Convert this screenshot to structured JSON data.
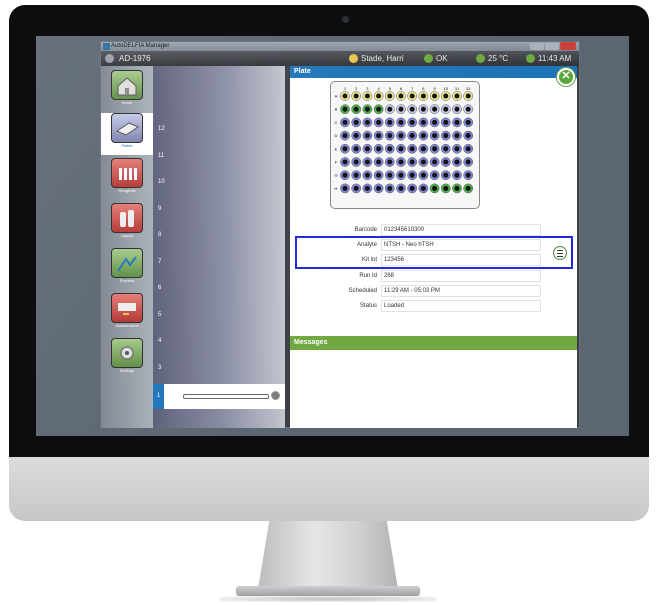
{
  "app": {
    "window_title": "AutoDELFIA Manager",
    "instrument_id": "AD-1976",
    "user": "Stade, Harri",
    "status": "OK",
    "temperature": "25 °C",
    "time": "11:43 AM"
  },
  "sidebar": {
    "items": [
      {
        "label": "Home",
        "icon": "home-icon",
        "color": "#6fa840"
      },
      {
        "label": "Plates",
        "icon": "plate-icon",
        "color": "#8a8fb0"
      },
      {
        "label": "Reagents",
        "icon": "reagents-icon",
        "color": "#c9403a"
      },
      {
        "label": "Liquids",
        "icon": "liquids-icon",
        "color": "#c9403a"
      },
      {
        "label": "Process",
        "icon": "process-icon",
        "color": "#6fa840"
      },
      {
        "label": "Maintenance",
        "icon": "maintenance-icon",
        "color": "#c9403a"
      },
      {
        "label": "Settings",
        "icon": "settings-icon",
        "color": "#6fa840"
      }
    ]
  },
  "slots": {
    "numbers": [
      "12",
      "11",
      "10",
      "9",
      "8",
      "7",
      "6",
      "5",
      "4",
      "3",
      "2",
      "1"
    ],
    "selected": "1"
  },
  "plate_panel": {
    "title": "Plate",
    "columns": [
      "1",
      "2",
      "3",
      "4",
      "5",
      "6",
      "7",
      "8",
      "9",
      "10",
      "11",
      "12"
    ],
    "rows": [
      "A",
      "B",
      "C",
      "D",
      "E",
      "F",
      "G",
      "H"
    ],
    "well_colors": {
      "yellow": "#f2e98c",
      "green": "#4cb04a",
      "blue": "#7f85d6",
      "white": "#ffffff"
    },
    "fields": [
      {
        "label": "Barcode",
        "value": "012345610300"
      },
      {
        "label": "Analyte",
        "value": "NTSH - Neo hTSH"
      },
      {
        "label": "Kit lot",
        "value": "123456"
      },
      {
        "label": "Run Id",
        "value": "268"
      },
      {
        "label": "Scheduled",
        "value": "11:29 AM - 05:03 PM"
      },
      {
        "label": "Status",
        "value": "Loaded"
      }
    ]
  },
  "messages": {
    "title": "Messages"
  },
  "colors": {
    "accent_blue": "#1e74b8",
    "accent_green": "#6fa840",
    "highlight_border": "#1d2bd8"
  }
}
